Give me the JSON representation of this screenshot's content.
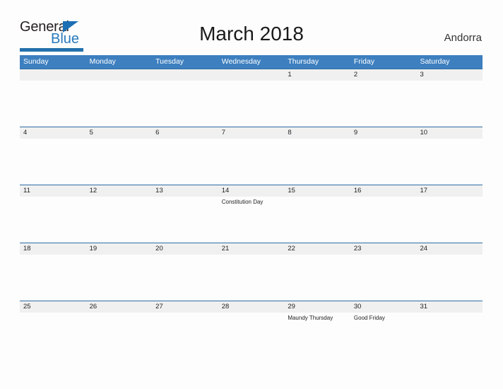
{
  "brand": {
    "name_part1": "General",
    "name_part2": "Blue",
    "triangle_icon": "triangle-icon",
    "accent_color": "#2879bd",
    "bar_color": "#2470ad"
  },
  "header": {
    "title": "March 2018",
    "country": "Andorra"
  },
  "calendar": {
    "header_bg": "#3d7fbf",
    "date_band_bg": "#f0f0f0",
    "rule_color": "#2e6da4",
    "weekdays": [
      "Sunday",
      "Monday",
      "Tuesday",
      "Wednesday",
      "Thursday",
      "Friday",
      "Saturday"
    ],
    "weeks": [
      [
        {
          "day": "",
          "event": ""
        },
        {
          "day": "",
          "event": ""
        },
        {
          "day": "",
          "event": ""
        },
        {
          "day": "",
          "event": ""
        },
        {
          "day": "1",
          "event": ""
        },
        {
          "day": "2",
          "event": ""
        },
        {
          "day": "3",
          "event": ""
        }
      ],
      [
        {
          "day": "4",
          "event": ""
        },
        {
          "day": "5",
          "event": ""
        },
        {
          "day": "6",
          "event": ""
        },
        {
          "day": "7",
          "event": ""
        },
        {
          "day": "8",
          "event": ""
        },
        {
          "day": "9",
          "event": ""
        },
        {
          "day": "10",
          "event": ""
        }
      ],
      [
        {
          "day": "11",
          "event": ""
        },
        {
          "day": "12",
          "event": ""
        },
        {
          "day": "13",
          "event": ""
        },
        {
          "day": "14",
          "event": "Constitution Day"
        },
        {
          "day": "15",
          "event": ""
        },
        {
          "day": "16",
          "event": ""
        },
        {
          "day": "17",
          "event": ""
        }
      ],
      [
        {
          "day": "18",
          "event": ""
        },
        {
          "day": "19",
          "event": ""
        },
        {
          "day": "20",
          "event": ""
        },
        {
          "day": "21",
          "event": ""
        },
        {
          "day": "22",
          "event": ""
        },
        {
          "day": "23",
          "event": ""
        },
        {
          "day": "24",
          "event": ""
        }
      ],
      [
        {
          "day": "25",
          "event": ""
        },
        {
          "day": "26",
          "event": ""
        },
        {
          "day": "27",
          "event": ""
        },
        {
          "day": "28",
          "event": ""
        },
        {
          "day": "29",
          "event": "Maundy Thursday"
        },
        {
          "day": "30",
          "event": "Good Friday"
        },
        {
          "day": "31",
          "event": ""
        }
      ]
    ]
  }
}
